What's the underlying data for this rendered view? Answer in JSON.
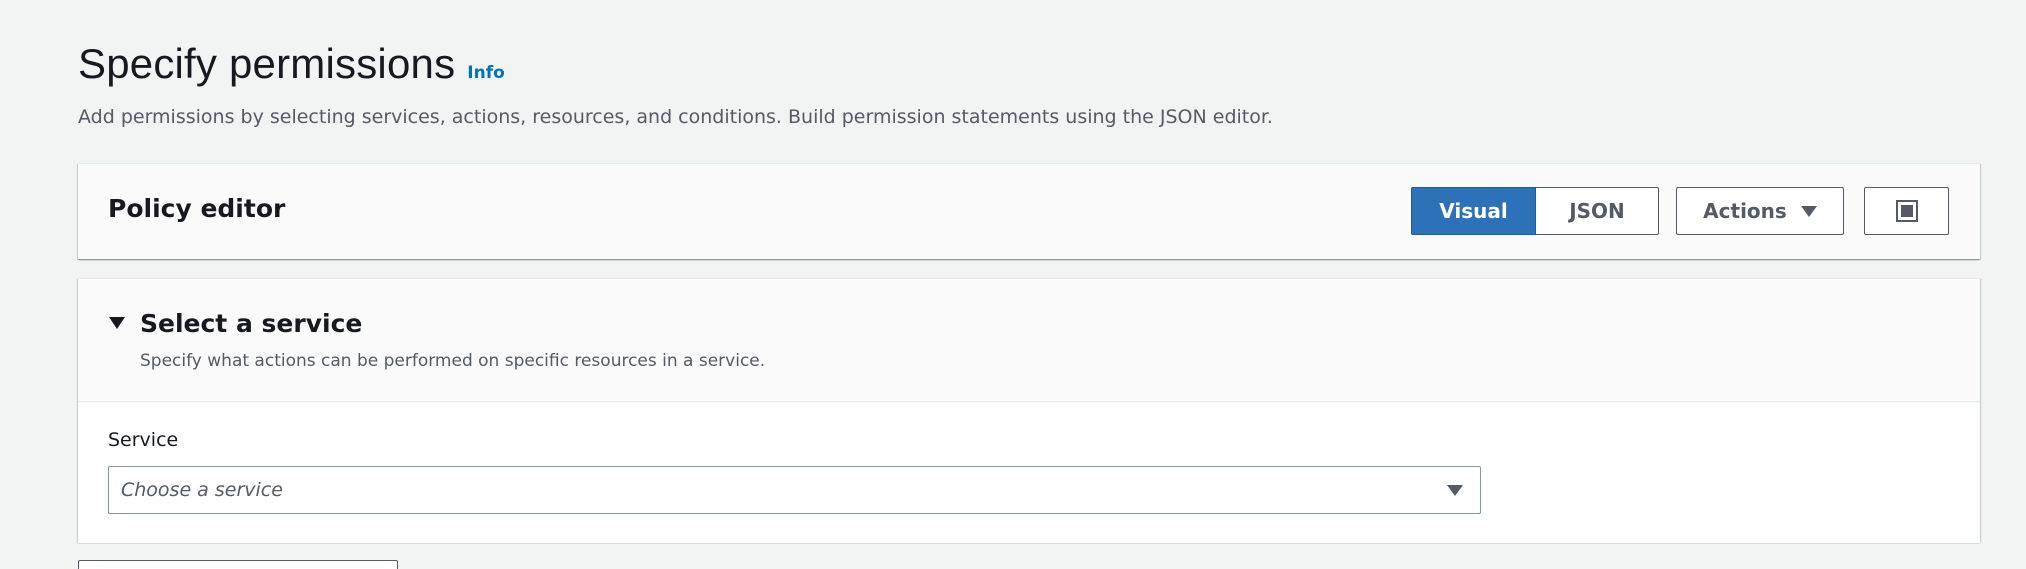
{
  "header": {
    "title": "Specify permissions",
    "info_link": "Info",
    "description": "Add permissions by selecting services, actions, resources, and conditions. Build permission statements using the JSON editor."
  },
  "policy_editor": {
    "title": "Policy editor",
    "mode_tabs": [
      {
        "label": "Visual",
        "selected": true
      },
      {
        "label": "JSON",
        "selected": false
      }
    ],
    "actions_label": "Actions",
    "fullscreen_icon": "fullscreen-icon"
  },
  "select_service": {
    "title": "Select a service",
    "description": "Specify what actions can be performed on specific resources in a service.",
    "field_label": "Service",
    "placeholder": "Choose a service",
    "expanded": true
  },
  "colors": {
    "primary": "#2d72b8",
    "link": "#0073bb",
    "background": "#f2f3f3",
    "text": "#16191f"
  }
}
